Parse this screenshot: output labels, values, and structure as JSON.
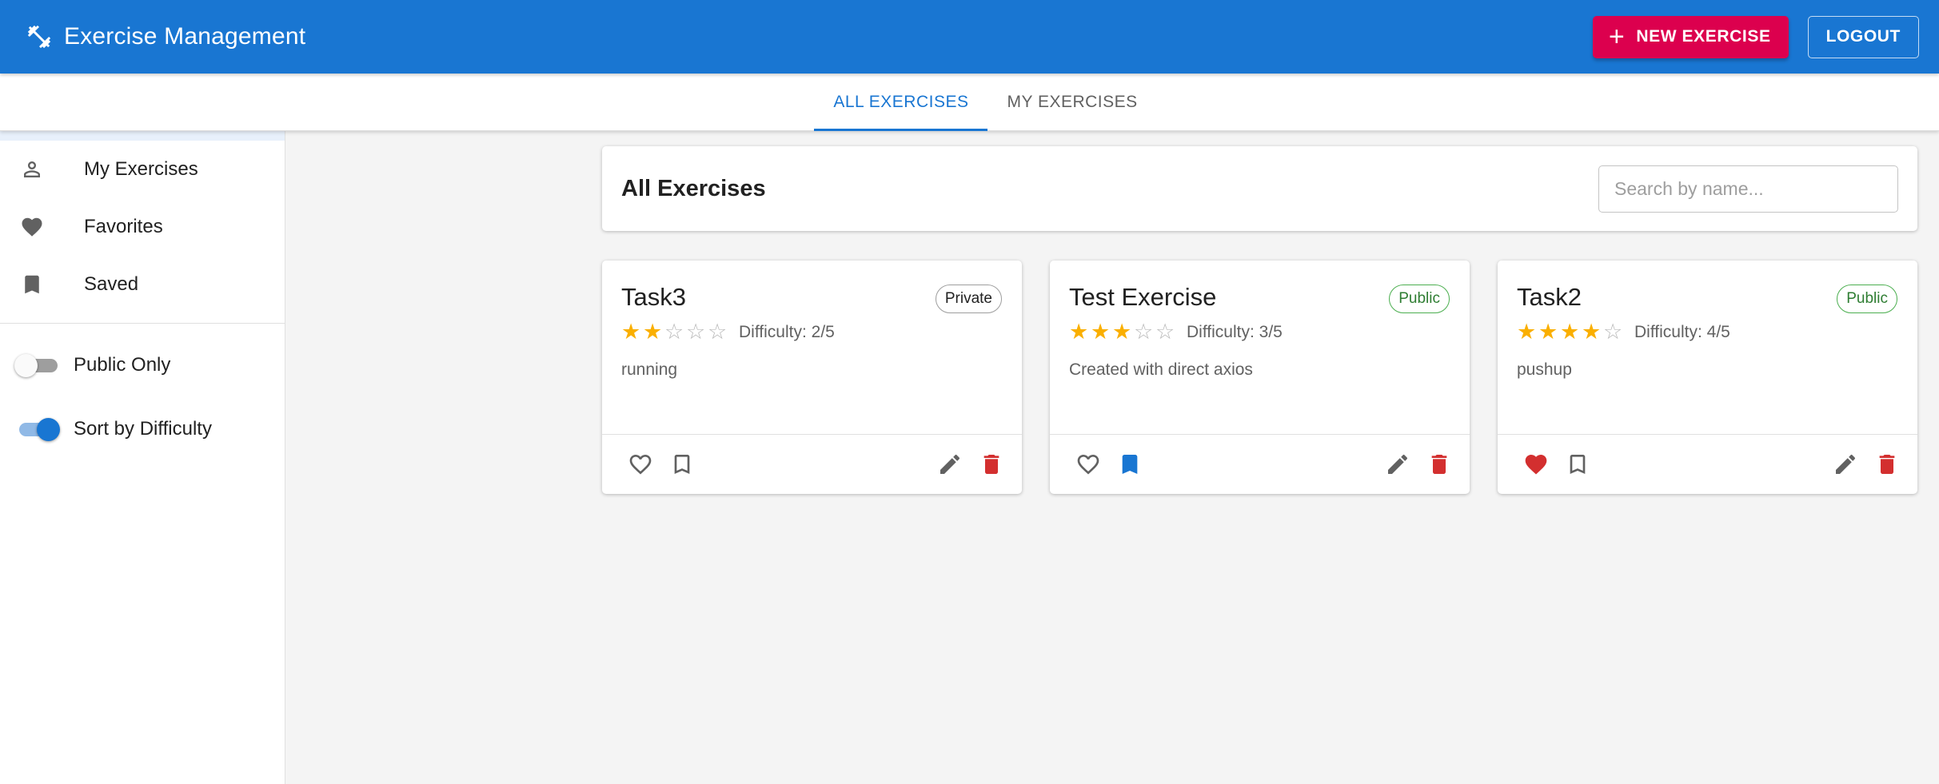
{
  "app": {
    "title": "Exercise Management",
    "brand_icon": "fitness-center-icon",
    "new_button_label": "NEW EXERCISE",
    "logout_label": "LOGOUT"
  },
  "tabs": [
    {
      "label": "ALL EXERCISES",
      "active": true
    },
    {
      "label": "MY EXERCISES",
      "active": false
    }
  ],
  "sidebar": {
    "items": [
      {
        "label": "My Exercises",
        "icon": "person-icon"
      },
      {
        "label": "Favorites",
        "icon": "heart-icon"
      },
      {
        "label": "Saved",
        "icon": "bookmark-icon"
      }
    ],
    "toggles": [
      {
        "label": "Public Only",
        "on": false
      },
      {
        "label": "Sort by Difficulty",
        "on": true
      }
    ]
  },
  "main": {
    "title": "All Exercises",
    "search_placeholder": "Search by name..."
  },
  "cards": [
    {
      "title": "Task3",
      "visibility": "Private",
      "rating": 2,
      "max_rating": 5,
      "difficulty_text": "Difficulty: 2/5",
      "description": "running",
      "favorited": false,
      "saved": false
    },
    {
      "title": "Test Exercise",
      "visibility": "Public",
      "rating": 3,
      "max_rating": 5,
      "difficulty_text": "Difficulty: 3/5",
      "description": "Created with direct axios",
      "favorited": false,
      "saved": true
    },
    {
      "title": "Task2",
      "visibility": "Public",
      "rating": 4,
      "max_rating": 5,
      "difficulty_text": "Difficulty: 4/5",
      "description": "pushup",
      "favorited": true,
      "saved": false
    }
  ],
  "colors": {
    "primary": "#1976d2",
    "secondary": "#dc004e",
    "delete": "#d32f2f",
    "favorite": "#d32f2f",
    "saved": "#1976d2",
    "star": "#faaf00",
    "public_chip": "#2e7d32"
  }
}
